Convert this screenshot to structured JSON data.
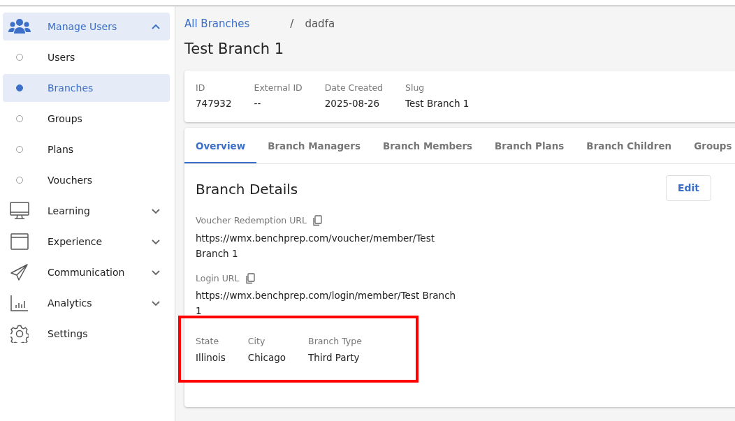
{
  "sidebar": {
    "sections": [
      {
        "label": "Manage Users",
        "active": true,
        "expanded": true,
        "children": [
          {
            "label": "Users",
            "selected": false
          },
          {
            "label": "Branches",
            "selected": true
          },
          {
            "label": "Groups",
            "selected": false
          },
          {
            "label": "Plans",
            "selected": false
          },
          {
            "label": "Vouchers",
            "selected": false
          }
        ]
      },
      {
        "label": "Learning",
        "active": false,
        "expanded": false
      },
      {
        "label": "Experience",
        "active": false,
        "expanded": false
      },
      {
        "label": "Communication",
        "active": false,
        "expanded": false
      },
      {
        "label": "Analytics",
        "active": false,
        "expanded": false
      },
      {
        "label": "Settings",
        "active": false
      }
    ]
  },
  "breadcrumb": [
    {
      "label": "All Branches",
      "link": true
    },
    {
      "label": "dadfa",
      "link": false
    }
  ],
  "breadcrumb_separator": "/",
  "title": "Test Branch 1",
  "summary": [
    {
      "label": "ID",
      "value": "747932"
    },
    {
      "label": "External ID",
      "value": "--"
    },
    {
      "label": "Date Created",
      "value": "2025-08-26"
    },
    {
      "label": "Slug",
      "value": "Test Branch 1"
    }
  ],
  "tabs": [
    {
      "label": "Overview",
      "selected": true
    },
    {
      "label": "Branch Managers",
      "selected": false
    },
    {
      "label": "Branch Members",
      "selected": false
    },
    {
      "label": "Branch Plans",
      "selected": false
    },
    {
      "label": "Branch Children",
      "selected": false
    },
    {
      "label": "Groups",
      "selected": false
    }
  ],
  "details": {
    "heading": "Branch Details",
    "edit_button": "Edit",
    "urls": [
      {
        "label": "Voucher Redemption URL",
        "value": "https://wmx.benchprep.com/voucher/member/Test Branch 1"
      },
      {
        "label": "Login URL",
        "value": "https://wmx.benchprep.com/login/member/Test Branch 1"
      }
    ],
    "fields": [
      {
        "label": "State",
        "value": "Illinois"
      },
      {
        "label": "City",
        "value": "Chicago"
      },
      {
        "label": "Branch Type",
        "value": "Third Party"
      }
    ],
    "highlighted": true
  }
}
